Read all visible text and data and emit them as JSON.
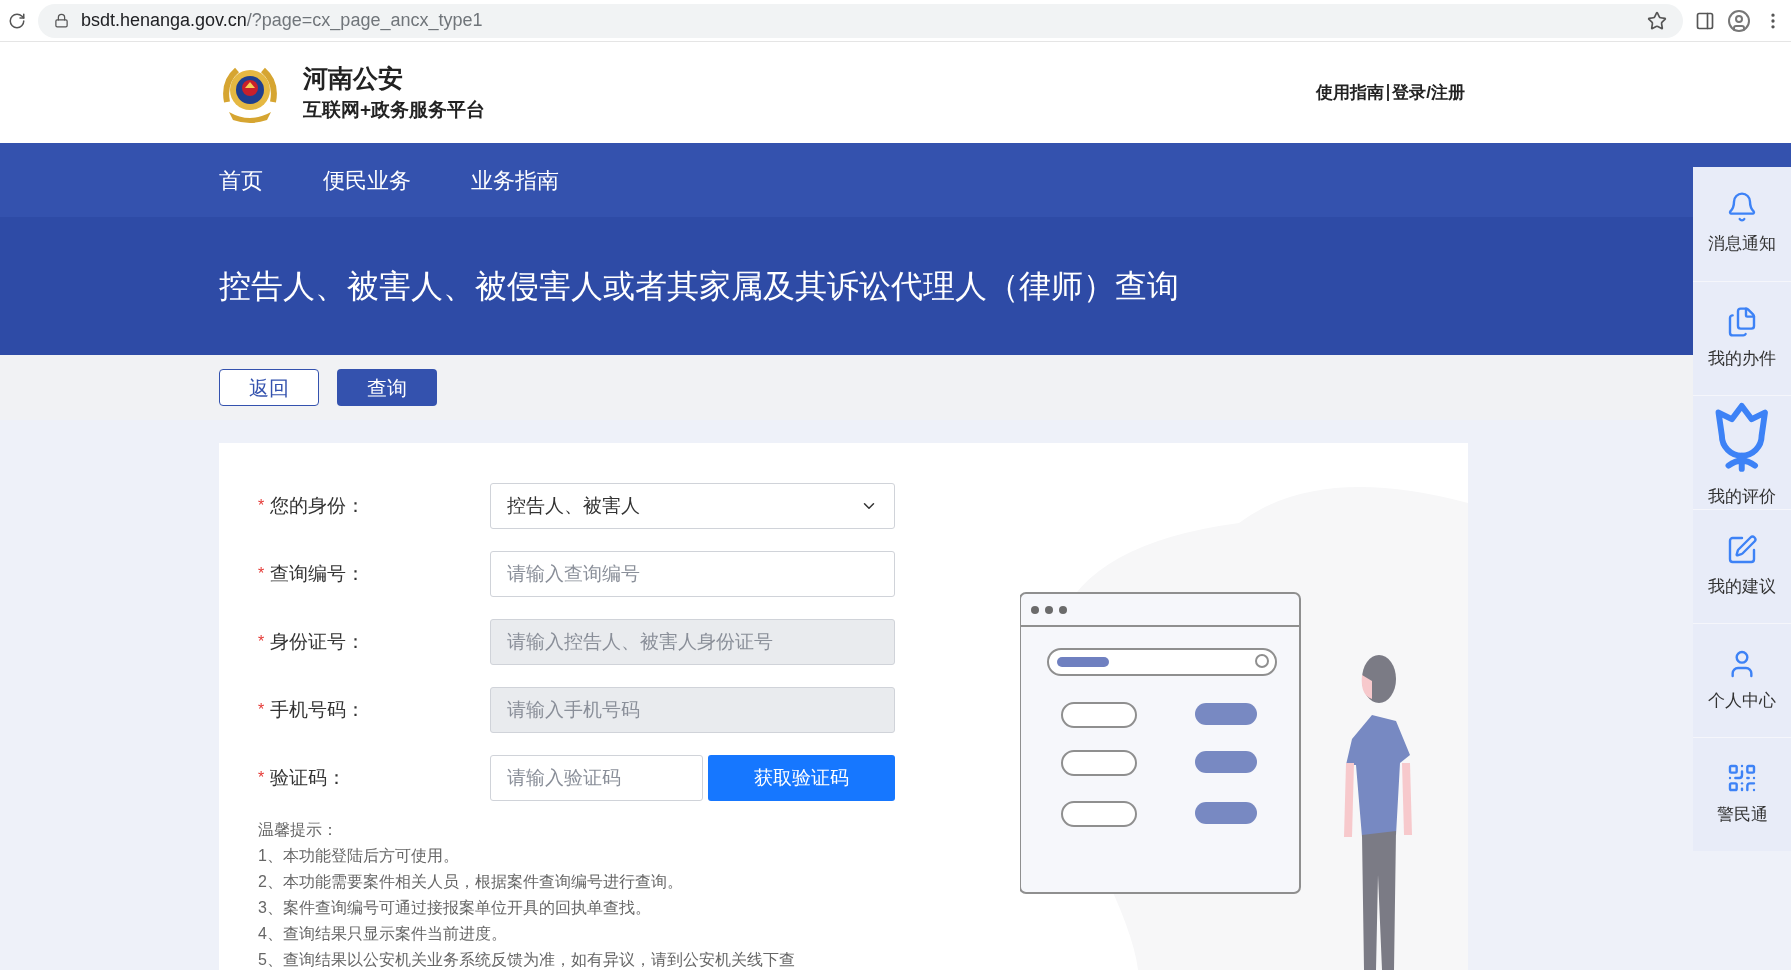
{
  "browser": {
    "url": {
      "host": "bsdt.henanga.gov.cn",
      "path": "/?page=cx_page_ancx_type1"
    }
  },
  "header": {
    "title": "河南公安",
    "subtitle": "互联网+政务服务平台",
    "links": [
      "使用指南",
      "登录/注册"
    ]
  },
  "nav": [
    "首页",
    "便民业务",
    "业务指南"
  ],
  "banner": {
    "title": "控告人、被害人、被侵害人或者其家属及其诉讼代理人（律师）查询"
  },
  "actions": [
    {
      "label": "返回",
      "kind": "outline"
    },
    {
      "label": "查询",
      "kind": "primary"
    }
  ],
  "form": {
    "fields": [
      {
        "mark": "*",
        "label": "您的身份：",
        "kind": "select",
        "value": "控告人、被害人"
      },
      {
        "mark": "*",
        "label": "查询编号：",
        "kind": "text",
        "placeholder": "请输入查询编号",
        "disabled": false
      },
      {
        "mark": "*",
        "label": "身份证号：",
        "kind": "text",
        "placeholder": "请输入控告人、被害人身份证号",
        "disabled": true
      },
      {
        "mark": "*",
        "label": "手机号码：",
        "kind": "text",
        "placeholder": "请输入手机号码",
        "disabled": true
      },
      {
        "mark": "*",
        "label": "验证码：",
        "kind": "captcha",
        "placeholder": "请输入验证码",
        "button": "获取验证码"
      }
    ],
    "tips_title": "温馨提示：",
    "tips": [
      "1、本功能登陆后方可使用。",
      "2、本功能需要案件相关人员，根据案件查询编号进行查询。",
      "3、案件查询编号可通过接报案单位开具的回执单查找。",
      "4、查询结果只显示案件当前进度。",
      "5、查询结果以公安机关业务系统反馈为准，如有异议，请到公安机关线下查"
    ]
  },
  "sidebar": [
    "消息通知",
    "我的办件",
    "我的评价",
    "我的建议",
    "个人中心",
    "警民通"
  ]
}
